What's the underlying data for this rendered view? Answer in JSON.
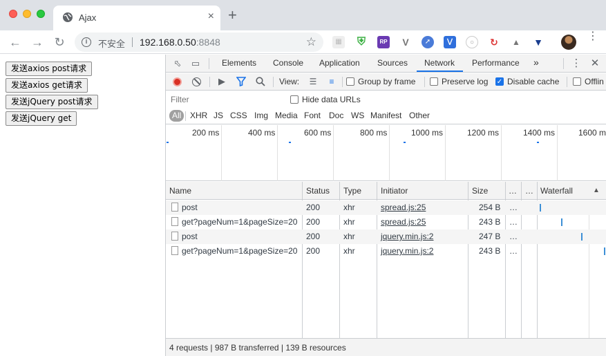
{
  "browser": {
    "tab_title": "Ajax",
    "tab_close": "×",
    "new_tab": "+",
    "security_label": "不安全",
    "url_host": "192.168.0.50",
    "url_port": ":8848",
    "icons": [
      "back-icon",
      "forward-icon",
      "reload-icon",
      "info-icon",
      "star-icon",
      "globe-icon"
    ]
  },
  "page": {
    "buttons": [
      "发送axios post请求",
      "发送axios get请求",
      "发送jQuery post请求",
      "发送jQuery get"
    ]
  },
  "devtools": {
    "tabs": [
      "Elements",
      "Console",
      "Application",
      "Sources",
      "Network",
      "Performance"
    ],
    "active_tab": "Network",
    "more_tabs": "»",
    "toolbar": {
      "view_label": "View:",
      "group_by_frame": "Group by frame",
      "group_by_frame_checked": false,
      "preserve_log": "Preserve log",
      "preserve_log_checked": false,
      "disable_cache": "Disable cache",
      "disable_cache_checked": true,
      "offline": "Offlin",
      "offline_checked": false
    },
    "filter": {
      "placeholder": "Filter",
      "hide_data_urls": "Hide data URLs",
      "hide_data_urls_checked": false
    },
    "type_filters": [
      "All",
      "XHR",
      "JS",
      "CSS",
      "Img",
      "Media",
      "Font",
      "Doc",
      "WS",
      "Manifest",
      "Other"
    ],
    "active_type_filter": "All",
    "overview_ticks": [
      "200 ms",
      "400 ms",
      "600 ms",
      "800 ms",
      "1000 ms",
      "1200 ms",
      "1400 ms",
      "1600 m"
    ],
    "columns": [
      "Name",
      "Status",
      "Type",
      "Initiator",
      "Size",
      "…",
      "…",
      "Waterfall"
    ],
    "sort_indicator": "▲",
    "requests": [
      {
        "name": "post",
        "status": "200",
        "type": "xhr",
        "initiator": "spread.js:25",
        "size": "254 B",
        "extra": "…"
      },
      {
        "name": "get?pageNum=1&pageSize=20",
        "status": "200",
        "type": "xhr",
        "initiator": "spread.js:25",
        "size": "243 B",
        "extra": "…"
      },
      {
        "name": "post",
        "status": "200",
        "type": "xhr",
        "initiator": "jquery.min.js:2",
        "size": "247 B",
        "extra": "…"
      },
      {
        "name": "get?pageNum=1&pageSize=20",
        "status": "200",
        "type": "xhr",
        "initiator": "jquery.min.js:2",
        "size": "243 B",
        "extra": "…"
      }
    ],
    "status_bar": "4 requests | 987 B transferred | 139 B resources"
  },
  "colors": {
    "accent": "#1a73e8",
    "record": "#d93025",
    "waterfall": "#3c8fd6"
  }
}
